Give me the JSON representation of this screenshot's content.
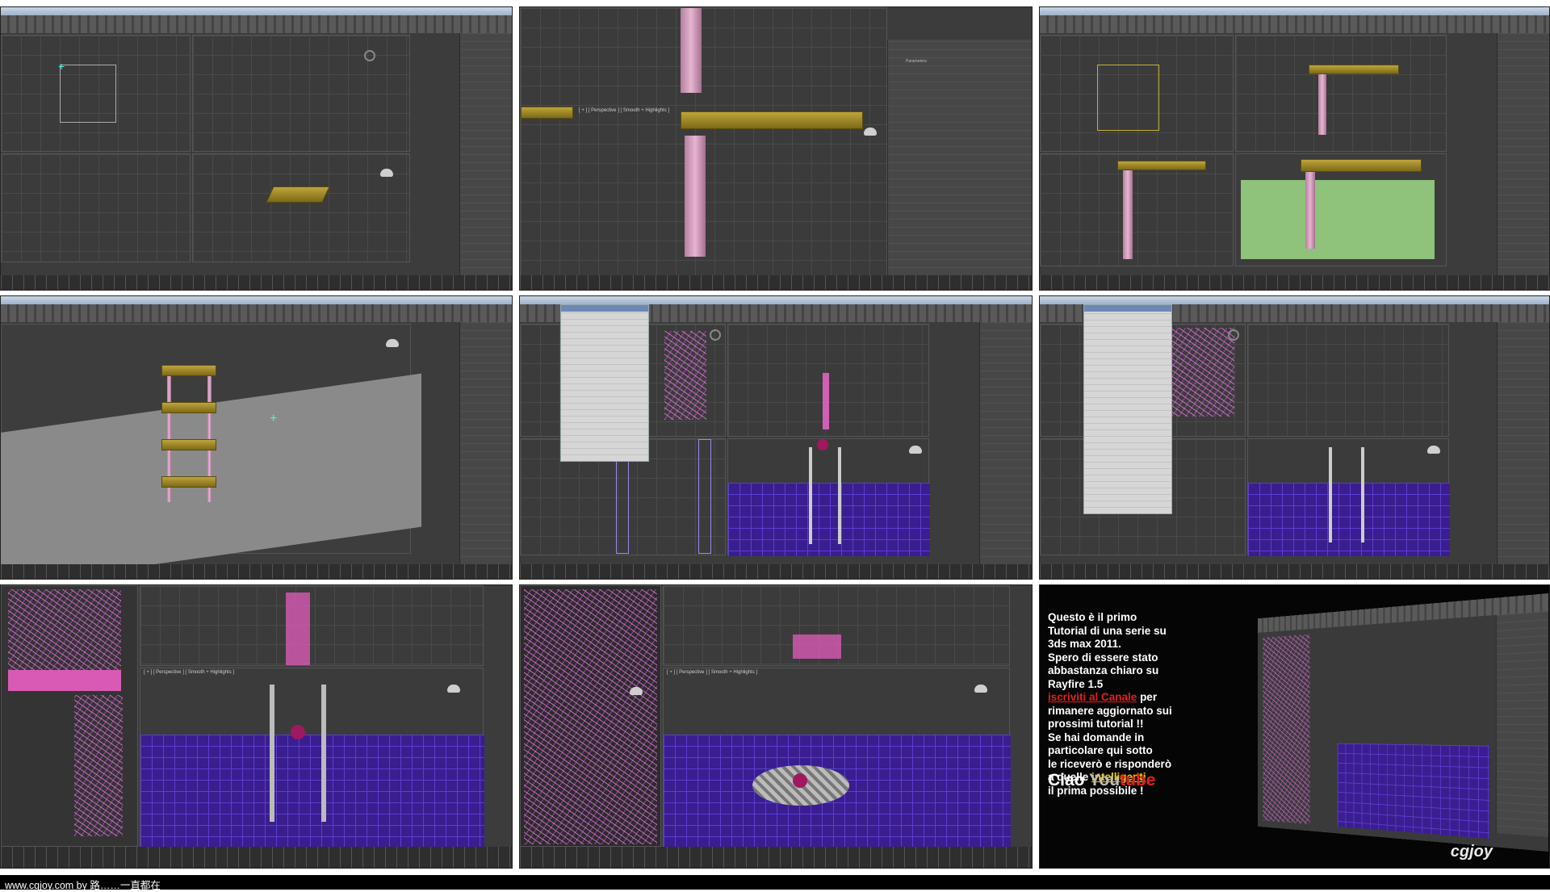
{
  "frames": [
    {
      "id": "frame-1",
      "description_label": ""
    },
    {
      "id": "frame-2",
      "viewport_label": "[ + ] [ Perspective ] [ Smooth + Highlights ]",
      "panel_title": "Parameters"
    },
    {
      "id": "frame-3"
    },
    {
      "id": "frame-4"
    },
    {
      "id": "frame-5"
    },
    {
      "id": "frame-6"
    },
    {
      "id": "frame-7",
      "viewport_label": "[ + ] [ Perspective ] [ Smooth + Highlights ]"
    },
    {
      "id": "frame-8",
      "viewport_label": "[ + ] [ Perspective ] [ Smooth + Highlights ]"
    }
  ],
  "promo": {
    "line1": "Questo è il primo",
    "line2": "Tutorial di una serie su",
    "line3": "3ds max 2011.",
    "line4": "Spero di essere stato",
    "line5": "abbastanza chiaro su",
    "line6": "Rayfire 1.5",
    "subscribe": "iscriviti al Canale",
    "subscribe_after": " per",
    "line8": "rimanere aggiornato sui",
    "line9": "prossimi tutorial !!",
    "line10": "Se hai domande in",
    "line11": "particolare qui sotto",
    "line12": "le riceverò e risponderò",
    "line13_before": "a quelle ",
    "line13_link": "intelligenti",
    "line14": "il prima possibile !",
    "ciao": "Ciao ",
    "you": "You",
    "tube": "tube"
  },
  "watermark": "cgjoy",
  "footer": "www.cgjoy.com by 路……一直都在",
  "colors": {
    "accent_red": "#e0201c",
    "link_yellow": "#f2d200",
    "viewport_purple": "#3a1d8f",
    "wire_pink": "#ff78dc"
  }
}
